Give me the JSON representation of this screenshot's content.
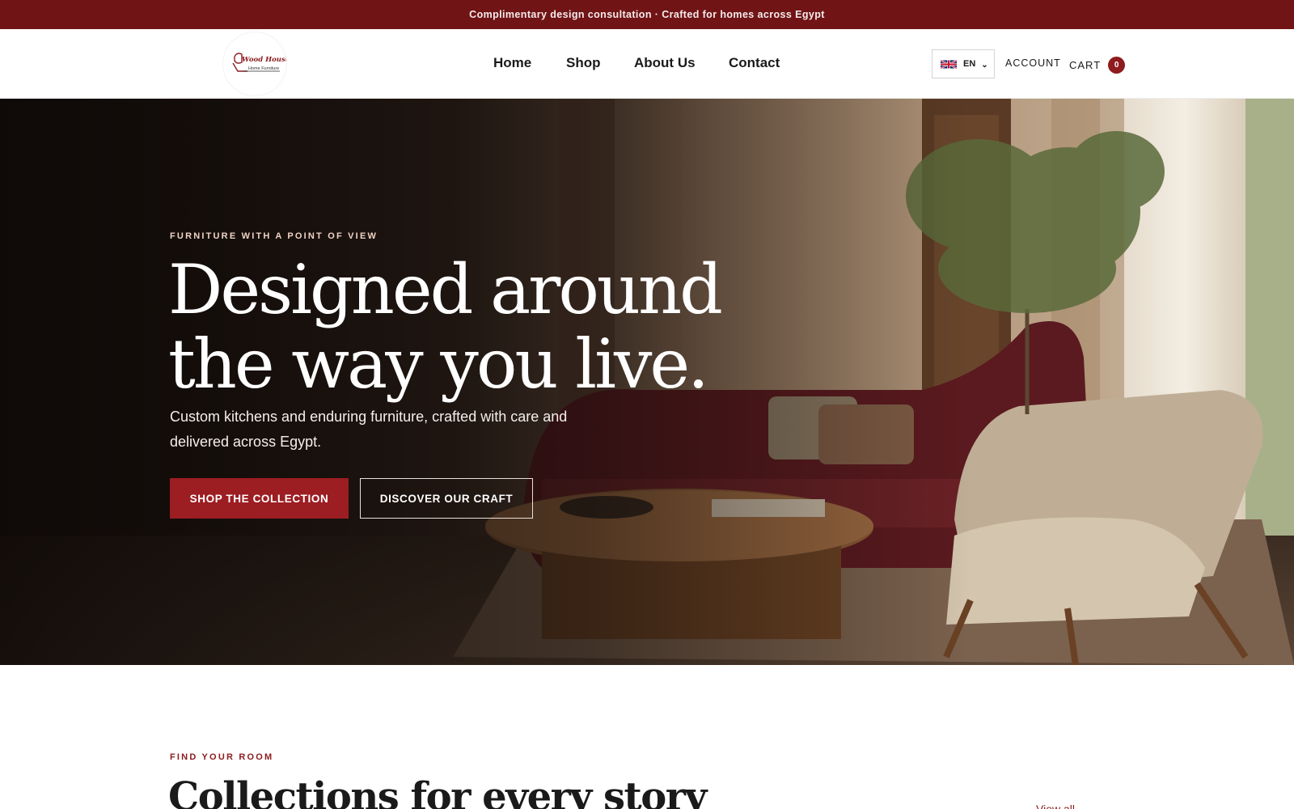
{
  "announcement": "Complimentary design consultation · Crafted for homes across Egypt",
  "logo": {
    "line1": "Wood House",
    "line2": "Home Furniture"
  },
  "nav": {
    "items": [
      "Home",
      "Shop",
      "About Us",
      "Contact"
    ]
  },
  "language": {
    "code": "EN",
    "flag_icon": "uk-flag-icon"
  },
  "account_label": "ACCOUNT",
  "cart": {
    "label": "CART",
    "count": "0"
  },
  "hero": {
    "eyebrow": "FURNITURE WITH A POINT OF VIEW",
    "title_line1": "Designed around",
    "title_line2": "the way you live.",
    "subtitle": "Custom kitchens and enduring furniture, crafted with care and delivered across Egypt.",
    "primary_cta": "SHOP THE COLLECTION",
    "secondary_cta": "DISCOVER OUR CRAFT"
  },
  "collections": {
    "eyebrow": "FIND YOUR ROOM",
    "title": "Collections for every story",
    "view_all": "View all"
  },
  "colors": {
    "brand": "#701416",
    "accent": "#9c1d22",
    "badge": "#8e1b1e"
  }
}
